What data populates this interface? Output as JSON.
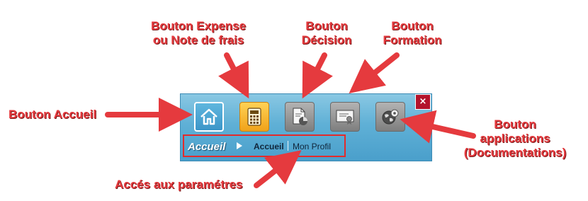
{
  "annotations": {
    "expense_line1": "Bouton Expense",
    "expense_line2": "ou Note de frais",
    "decision_line1": "Bouton",
    "decision_line2": "Décision",
    "formation_line1": "Bouton",
    "formation_line2": "Formation",
    "accueil": "Bouton  Accueil",
    "apps_line1": "Bouton",
    "apps_line2": "applications",
    "apps_line3": "(Documentations)",
    "parametres": "Accés aux paramétres"
  },
  "toolbar": {
    "close_label": "×",
    "buttons": [
      {
        "name": "home",
        "icon": "home-icon"
      },
      {
        "name": "expense",
        "icon": "calculator-icon"
      },
      {
        "name": "decision",
        "icon": "document-chart-icon"
      },
      {
        "name": "formation",
        "icon": "certificate-icon"
      },
      {
        "name": "applications",
        "icon": "globe-gear-icon"
      }
    ]
  },
  "nav": {
    "title": "Accueil",
    "accueil": "Accueil",
    "profil": "Mon Profil"
  },
  "colors": {
    "annotation": "#e53a3e",
    "panel": "#5fb0d6",
    "close": "#b3132b",
    "expense_button": "#f5b52f"
  }
}
